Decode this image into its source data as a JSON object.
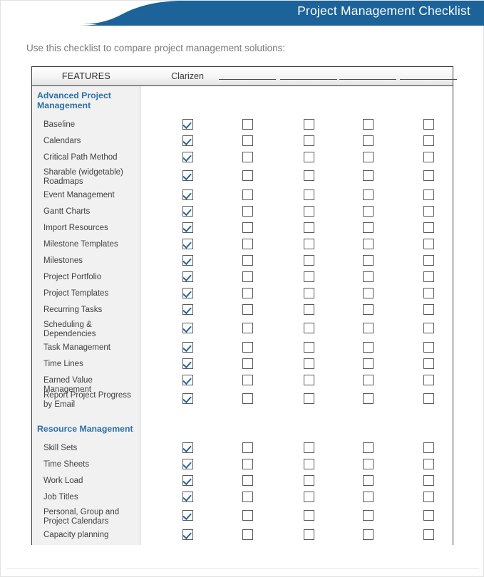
{
  "banner": {
    "title": "Project Management Checklist",
    "color": "#1b6399",
    "text_color": "#ffffff"
  },
  "intro": {
    "text": "Use this checklist to compare project management solutions:"
  },
  "table": {
    "features_header": "FEATURES",
    "columns": [
      {
        "label": "Clarizen",
        "has_rule": false
      },
      {
        "label": "",
        "has_rule": true
      },
      {
        "label": "",
        "has_rule": true
      },
      {
        "label": "",
        "has_rule": true
      },
      {
        "label": "",
        "has_rule": true
      }
    ],
    "accent_color": "#2e6fa7",
    "check_color": "#2a6496",
    "feature_column_bg": "#f1f1f1",
    "sections": [
      {
        "title": "Advanced Project Management",
        "rows": [
          {
            "label": "Baseline",
            "checks": [
              true,
              false,
              false,
              false,
              false
            ]
          },
          {
            "label": "Calendars",
            "checks": [
              true,
              false,
              false,
              false,
              false
            ]
          },
          {
            "label": "Critical Path Method",
            "checks": [
              true,
              false,
              false,
              false,
              false
            ]
          },
          {
            "label": "Sharable (widgetable) Roadmaps",
            "checks": [
              true,
              false,
              false,
              false,
              false
            ]
          },
          {
            "label": "Event Management",
            "checks": [
              true,
              false,
              false,
              false,
              false
            ]
          },
          {
            "label": "Gantt Charts",
            "checks": [
              true,
              false,
              false,
              false,
              false
            ]
          },
          {
            "label": "Import Resources",
            "checks": [
              true,
              false,
              false,
              false,
              false
            ]
          },
          {
            "label": "Milestone Templates",
            "checks": [
              true,
              false,
              false,
              false,
              false
            ]
          },
          {
            "label": "Milestones",
            "checks": [
              true,
              false,
              false,
              false,
              false
            ]
          },
          {
            "label": "Project Portfolio",
            "checks": [
              true,
              false,
              false,
              false,
              false
            ]
          },
          {
            "label": "Project Templates",
            "checks": [
              true,
              false,
              false,
              false,
              false
            ]
          },
          {
            "label": "Recurring Tasks",
            "checks": [
              true,
              false,
              false,
              false,
              false
            ]
          },
          {
            "label": "Scheduling & Dependencies",
            "checks": [
              true,
              false,
              false,
              false,
              false
            ]
          },
          {
            "label": "Task Management",
            "checks": [
              true,
              false,
              false,
              false,
              false
            ]
          },
          {
            "label": "Time Lines",
            "checks": [
              true,
              false,
              false,
              false,
              false
            ]
          },
          {
            "label": "Earned Value Management",
            "checks": [
              true,
              false,
              false,
              false,
              false
            ]
          },
          {
            "label": "Report Project Progress by Email",
            "checks": [
              true,
              false,
              false,
              false,
              false
            ]
          }
        ]
      },
      {
        "title": "Resource Management",
        "rows": [
          {
            "label": "Skill Sets",
            "checks": [
              true,
              false,
              false,
              false,
              false
            ]
          },
          {
            "label": "Time Sheets",
            "checks": [
              true,
              false,
              false,
              false,
              false
            ]
          },
          {
            "label": "Work Load",
            "checks": [
              true,
              false,
              false,
              false,
              false
            ]
          },
          {
            "label": "Job Titles",
            "checks": [
              true,
              false,
              false,
              false,
              false
            ]
          },
          {
            "label": "Personal, Group and Project Calendars",
            "checks": [
              true,
              false,
              false,
              false,
              false
            ]
          },
          {
            "label": "Capacity planning",
            "checks": [
              true,
              false,
              false,
              false,
              false
            ]
          }
        ]
      }
    ]
  }
}
